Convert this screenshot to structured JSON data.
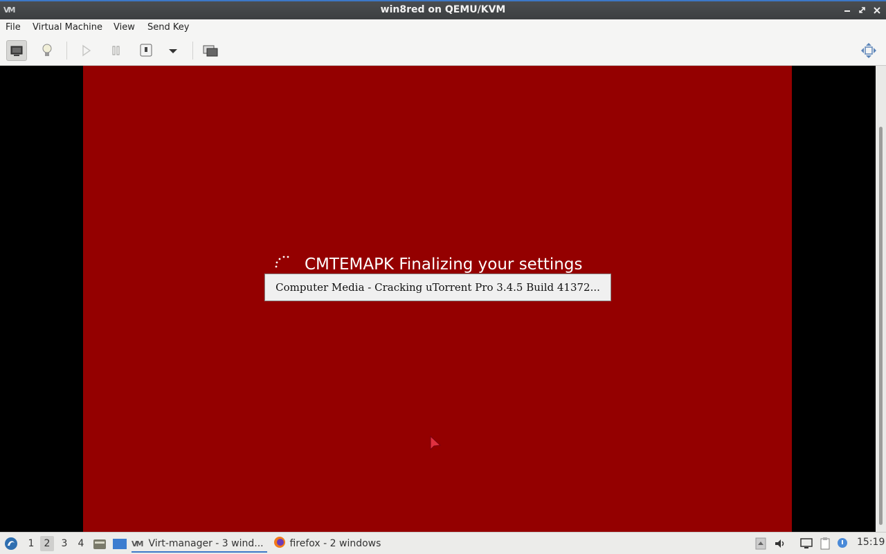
{
  "window": {
    "title": "win8red on QEMU/KVM"
  },
  "menu": [
    "File",
    "Virtual Machine",
    "View",
    "Send Key"
  ],
  "toolbar_icons": [
    "console-icon",
    "details-lightbulb-icon",
    "run-icon",
    "pause-icon",
    "shutdown-icon",
    "shutdown-dropdown-icon",
    "snapshots-icon",
    "fullscreen-icon"
  ],
  "guest": {
    "background_color": "#940000",
    "setup_text": "CMTEMAPK Finalizing your settings",
    "popup_text": "Computer Media - Cracking uTorrent Pro 3.4.5 Build 41372..."
  },
  "taskbar": {
    "workspaces": [
      "1",
      "2",
      "3",
      "4"
    ],
    "active_workspace": "2",
    "tasks": [
      {
        "label": "Virt-manager - 3 wind...",
        "icon": "virt-manager-icon"
      },
      {
        "label": "firefox - 2 windows",
        "icon": "firefox-icon"
      }
    ],
    "clock": "15:19"
  }
}
